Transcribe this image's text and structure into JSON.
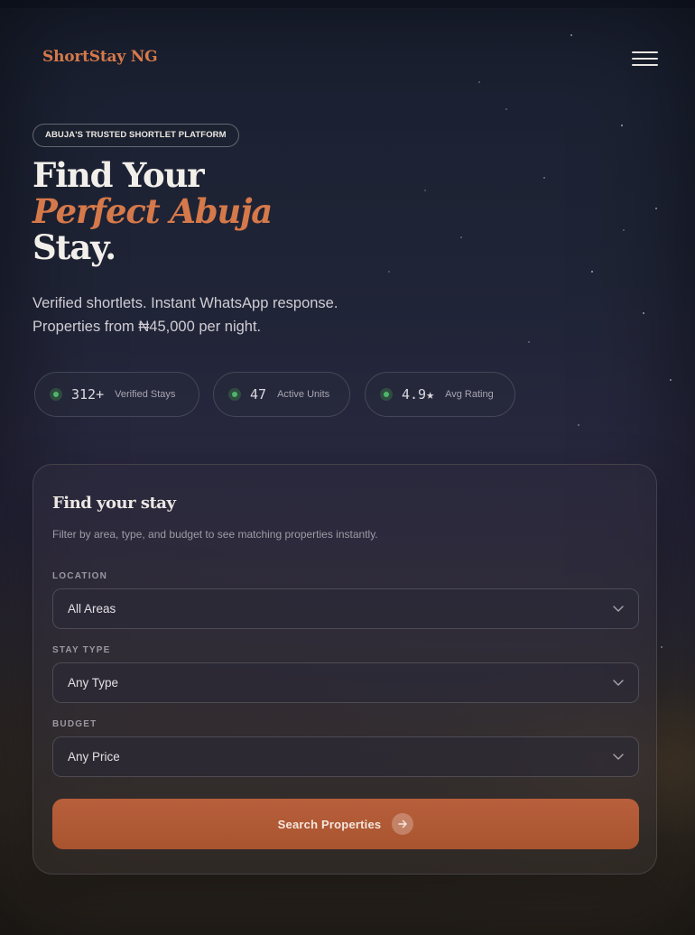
{
  "brand": {
    "name": "ShortStay NG",
    "accent": "#d6794a"
  },
  "nav": {
    "menu_icon": "hamburger-menu-icon"
  },
  "hero": {
    "badge": "ABUJA'S TRUSTED SHORTLET PLATFORM",
    "title_line1": "Find Your",
    "title_line2": "Perfect Abuja",
    "title_line3": "Stay.",
    "subtitle_line1": "Verified shortlets. Instant WhatsApp response.",
    "subtitle_line2": "Properties from ₦45,000 per night."
  },
  "stats": [
    {
      "value": "312+",
      "label": "Verified Stays"
    },
    {
      "value": "47",
      "label": "Active Units"
    },
    {
      "value": "4.9★",
      "label": "Avg Rating"
    }
  ],
  "search": {
    "title": "Find your stay",
    "description": "Filter by area, type, and budget to see matching properties instantly.",
    "location_label": "LOCATION",
    "location_value": "All Areas",
    "type_label": "STAY TYPE",
    "type_value": "Any Type",
    "budget_label": "BUDGET",
    "budget_value": "Any Price",
    "button_label": "Search Properties"
  },
  "colors": {
    "button": "#b85f3c",
    "status_dot": "#4fb56a"
  }
}
